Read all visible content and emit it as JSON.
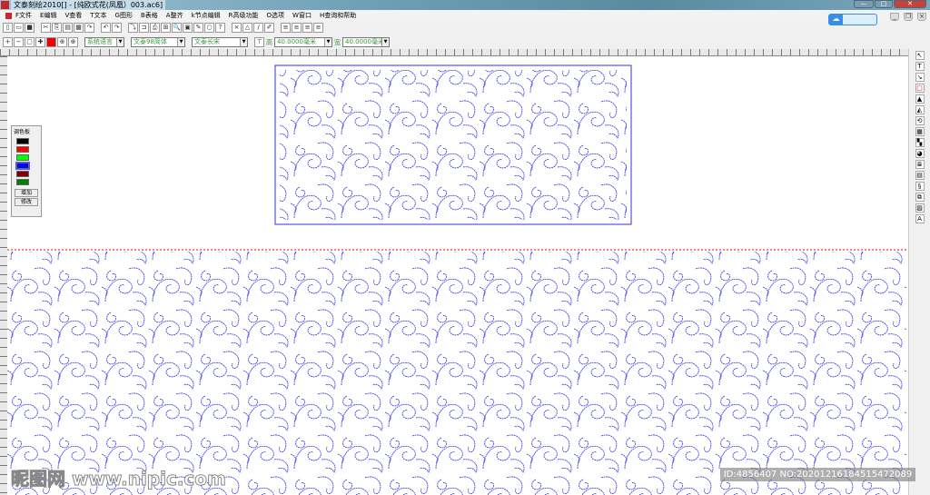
{
  "window": {
    "title": "文泰刻绘2010[] - [纯欧式花(凤凰）003.ac6]",
    "minimize": "—",
    "maximize": "□",
    "close": "✕"
  },
  "menu": [
    "F文件",
    "E编辑",
    "V查看",
    "T文本",
    "G图形",
    "B表格",
    "A整齐",
    "k节点编辑",
    "R高级功能",
    "O选项",
    "W窗口",
    "H查询和帮助"
  ],
  "toolbar": {
    "language": "系统语言",
    "font1": "文泰98简体",
    "font2": "文泰长宋",
    "height_label": "高",
    "height_value": "40.0000毫米",
    "width_label": "宽",
    "width_value": "40.0000毫米"
  },
  "palette": {
    "title": "调色板",
    "colors": [
      "#000000",
      "#ff0000",
      "#00ff00",
      "#0000ff",
      "#800000",
      "#008000"
    ],
    "add": "增加",
    "edit": "修改"
  },
  "design": {
    "stroke": "#3030e0",
    "guide": "#ff0000"
  },
  "watermark": {
    "site": "昵图网 www.nipic.com",
    "id": "ID:4856407 NO:20201216184515472089"
  }
}
